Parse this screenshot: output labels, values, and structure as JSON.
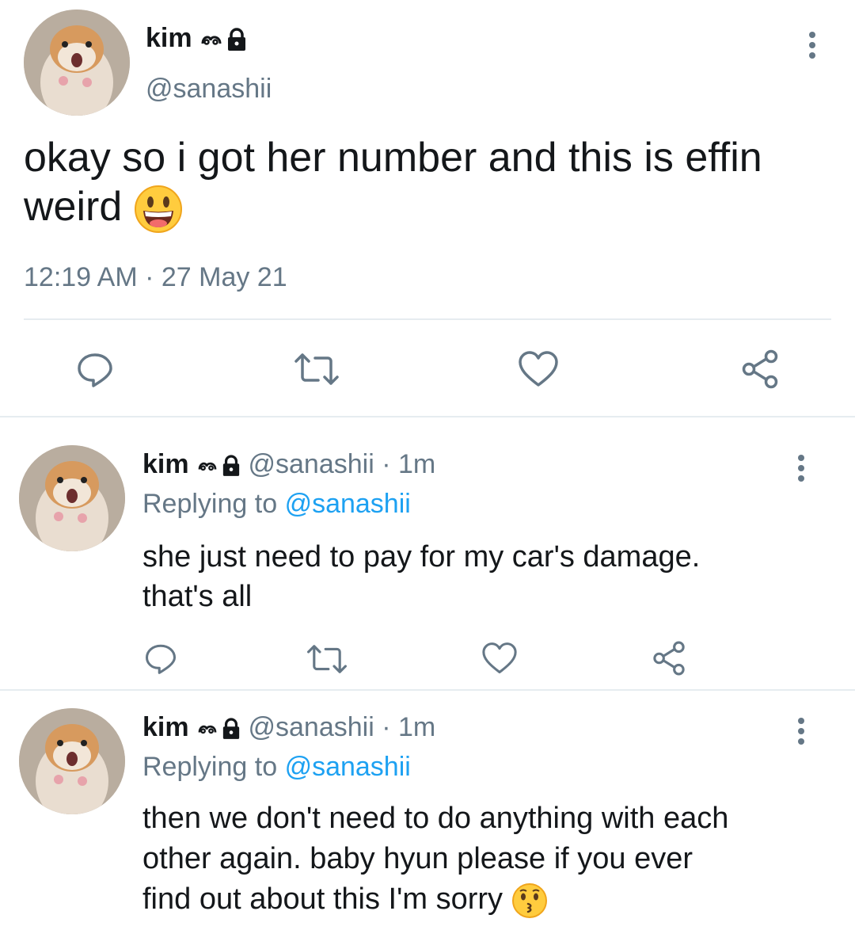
{
  "main_tweet": {
    "display_name": "kim",
    "handle": "@sanashii",
    "text": "okay so i got her number and this is effin weird",
    "emoji": "grinning-face",
    "timestamp": "12:19 AM · 27 May 21"
  },
  "replies": [
    {
      "display_name": "kim",
      "handle": "@sanashii",
      "age": "· 1m",
      "replying_label": "Replying to",
      "replying_handle": "@sanashii",
      "text_line1": "she just need to pay for my car's damage.",
      "text_line2": "that's all"
    },
    {
      "display_name": "kim",
      "handle": "@sanashii",
      "age": "· 1m",
      "replying_label": "Replying to",
      "replying_handle": "@sanashii",
      "text_line1": "then we don't need to do anything with each",
      "text_line2": "other again. baby hyun please if you ever",
      "text_line3": "find out about this I'm sorry",
      "emoji": "kissing-face"
    }
  ],
  "icons": [
    "reply-icon",
    "retweet-icon",
    "like-icon",
    "share-icon",
    "more-icon",
    "lock-icon"
  ],
  "colors": {
    "link": "#1da1f2",
    "muted": "#657786",
    "text": "#14171a",
    "divider": "#e6ecf0"
  }
}
